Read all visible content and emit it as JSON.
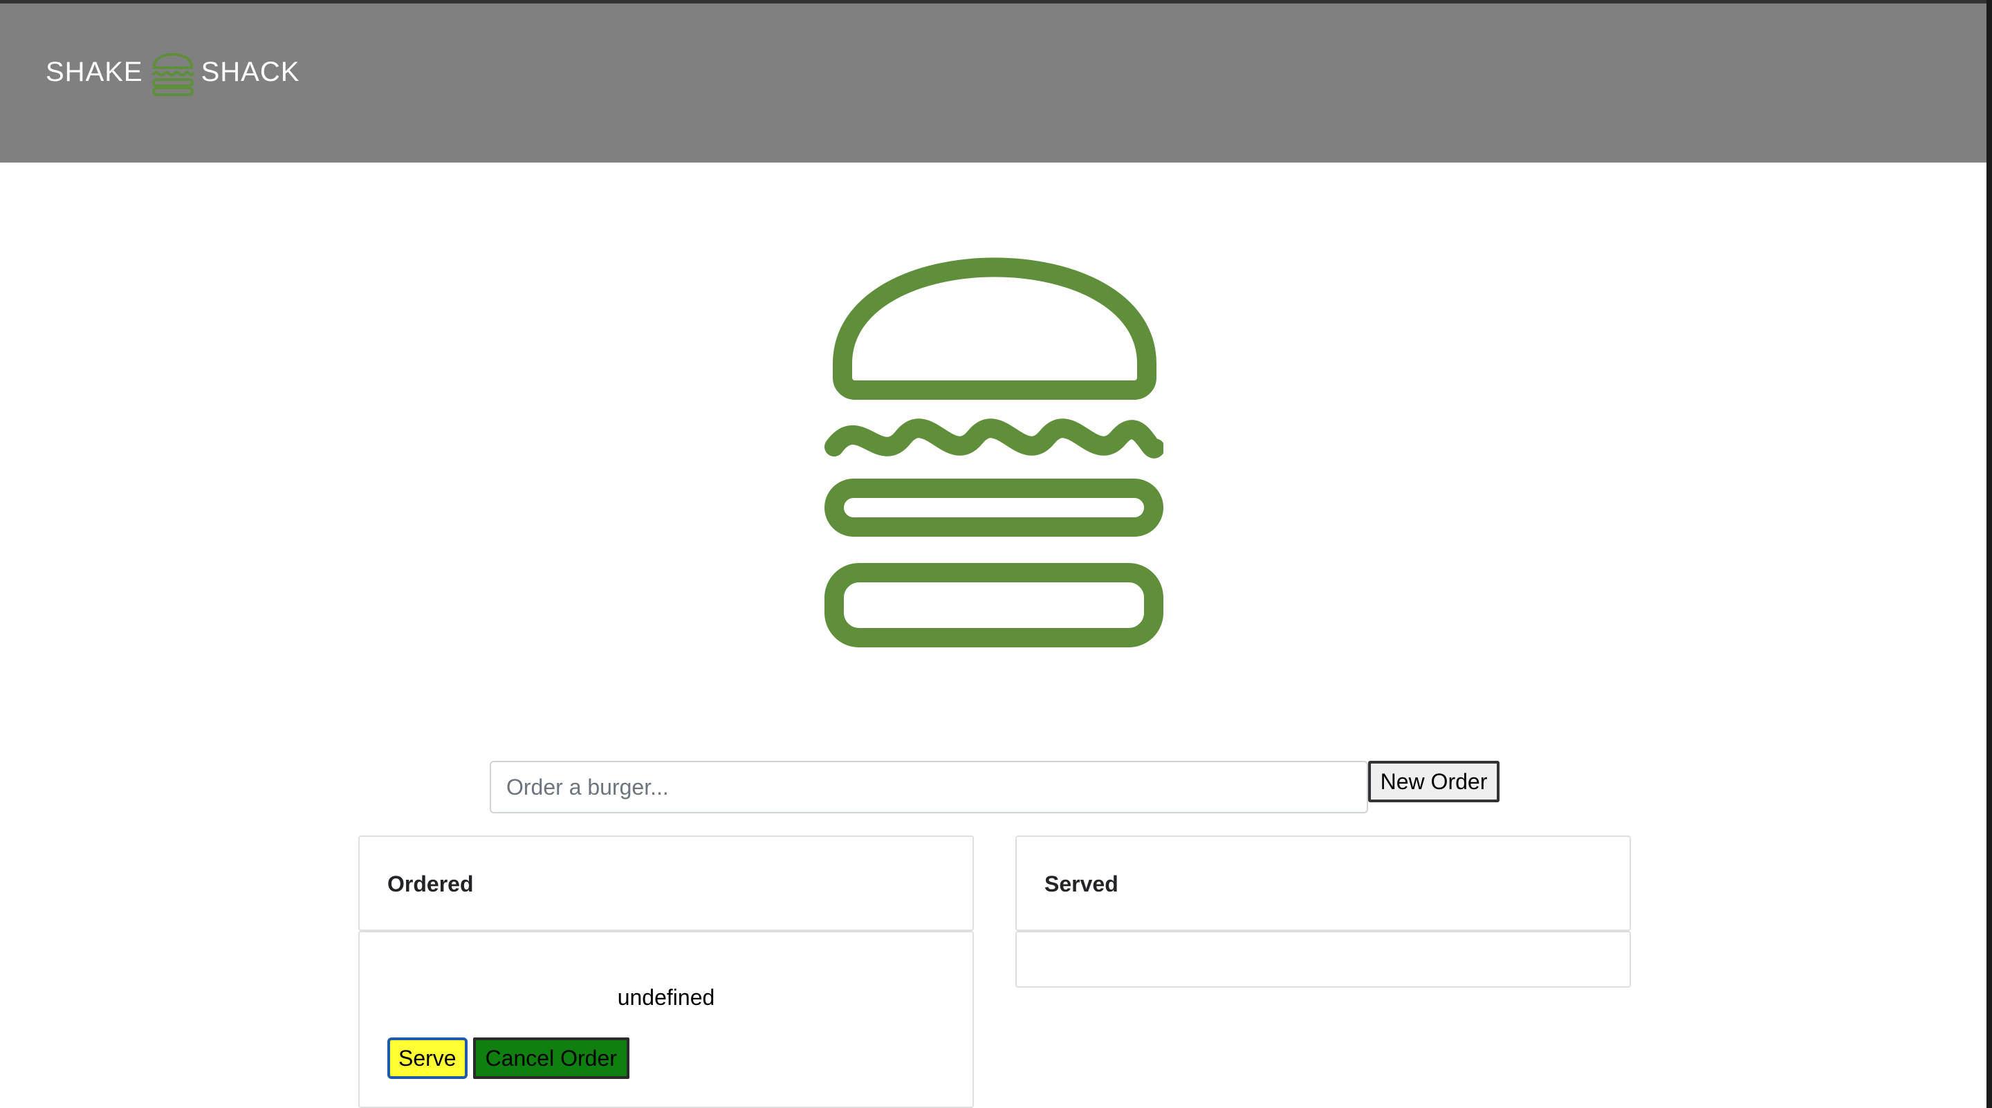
{
  "brand": {
    "left_word": "SHAKE",
    "right_word": "SHACK",
    "logo_icon": "burger-logo-icon",
    "accent_color": "#5f8f3a"
  },
  "hero": {
    "icon": "burger-icon"
  },
  "order_form": {
    "placeholder": "Order a burger...",
    "value": "",
    "new_order_label": "New Order"
  },
  "columns": {
    "ordered_title": "Ordered",
    "served_title": "Served"
  },
  "ordered_items": [
    {
      "name": "undefined",
      "serve_label": "Serve",
      "cancel_label": "Cancel Order"
    }
  ],
  "served_items": [],
  "colors": {
    "header_bg": "#808080",
    "serve_button": "#ffff33",
    "cancel_button": "#0f7f0f"
  }
}
